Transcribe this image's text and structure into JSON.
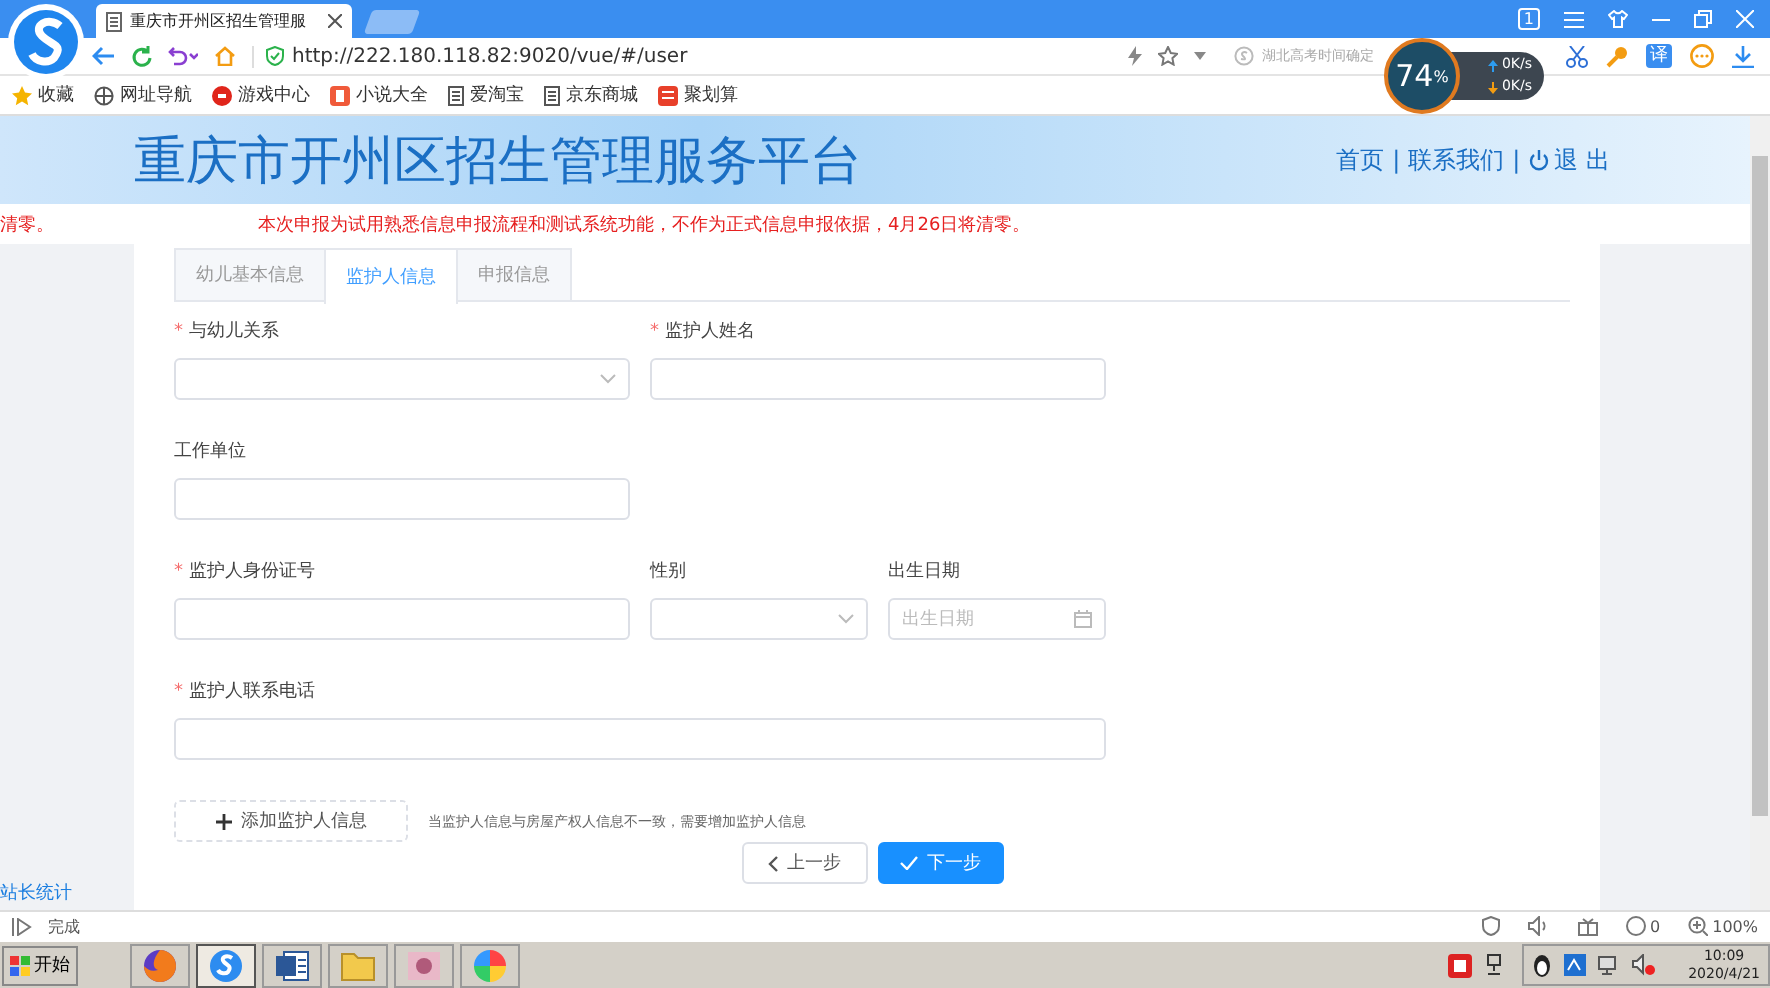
{
  "browser": {
    "tab_title": "重庆市开州区招生管理服",
    "window_count": "1",
    "url": "http://222.180.118.82:9020/vue/#/user",
    "search": {
      "placeholder": "湖北高考时间确定"
    },
    "translate_label": "译",
    "bookmarks": [
      {
        "kind": "star",
        "label": "收藏"
      },
      {
        "kind": "globe",
        "label": "网址导航"
      },
      {
        "kind": "game",
        "label": "游戏中心"
      },
      {
        "kind": "novel",
        "label": "小说大全"
      },
      {
        "kind": "page",
        "label": "爱淘宝"
      },
      {
        "kind": "page",
        "label": "京东商城"
      },
      {
        "kind": "deal",
        "label": "聚划算"
      }
    ]
  },
  "speed_widget": {
    "percent": "74",
    "unit": "%",
    "upload": "0K/s",
    "download": "0K/s"
  },
  "header": {
    "title": "重庆市开州区招生管理服务平台",
    "separator": "|",
    "nav": [
      {
        "kind": "link",
        "label": "首页"
      },
      {
        "kind": "link",
        "label": "联系我们"
      },
      {
        "kind": "logout",
        "label": "退 出"
      }
    ]
  },
  "notice": [
    "清零。",
    "本次申报为试用熟悉信息申报流程和测试系统功能，不作为正式信息申报依据，4月26日将清零。"
  ],
  "required_mark": "*",
  "tabs": [
    {
      "label": "幼儿基本信息",
      "selected": false
    },
    {
      "label": "监护人信息",
      "selected": true
    },
    {
      "label": "申报信息",
      "selected": false
    }
  ],
  "form_rows": [
    [
      {
        "label": "与幼儿关系",
        "required": true,
        "kind": "select"
      },
      {
        "label": "监护人姓名",
        "required": true,
        "kind": "input"
      }
    ],
    [
      {
        "label": "工作单位",
        "required": false,
        "kind": "input"
      }
    ],
    [
      {
        "label": "监护人身份证号",
        "required": true,
        "kind": "input"
      },
      {
        "label": "性别",
        "required": false,
        "kind": "select"
      },
      {
        "label": "出生日期",
        "required": false,
        "kind": "date",
        "placeholder": "出生日期"
      }
    ],
    [
      {
        "label": "监护人联系电话",
        "required": true,
        "kind": "input"
      }
    ]
  ],
  "add_button": "添加监护人信息",
  "add_hint": "当监护人信息与房屋产权人信息不一致，需要增加监护人信息",
  "steps": [
    {
      "kind": "prev",
      "label": "上一步"
    },
    {
      "kind": "next",
      "label": "下一步"
    }
  ],
  "footer_link": "站长统计",
  "status_bar": {
    "text": "完成",
    "counter": "0",
    "zoom": "100%"
  },
  "taskbar": {
    "start": "开始",
    "apps": [
      {
        "kind": "firefox",
        "selected": false
      },
      {
        "kind": "browser",
        "selected": true
      },
      {
        "kind": "word",
        "selected": false
      },
      {
        "kind": "folder",
        "selected": false
      },
      {
        "kind": "image",
        "selected": false
      },
      {
        "kind": "pinwheel",
        "selected": false
      }
    ],
    "time": "10:09",
    "date": "2020/4/21"
  }
}
